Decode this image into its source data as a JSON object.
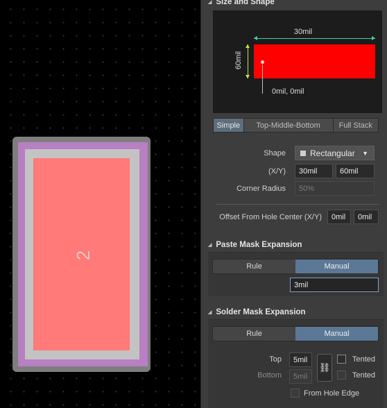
{
  "canvas": {
    "pad_designator": "2"
  },
  "size_and_shape": {
    "title": "Size and Shape",
    "preview": {
      "width_label": "30mil",
      "height_label": "60mil",
      "origin_label": "0mil, 0mil"
    },
    "modes": [
      "Simple",
      "Top-Middle-Bottom",
      "Full Stack"
    ],
    "active_mode": "Simple",
    "shape_label": "Shape",
    "shape_value": "Rectangular",
    "xy_label": "(X/Y)",
    "x_value": "30mil",
    "y_value": "60mil",
    "corner_radius_label": "Corner Radius",
    "corner_radius_value": "50%",
    "offset_label": "Offset From Hole Center (X/Y)",
    "offset_x": "0mil",
    "offset_y": "0mil"
  },
  "paste_mask": {
    "title": "Paste Mask Expansion",
    "rule_label": "Rule",
    "manual_label": "Manual",
    "active": "Manual",
    "value": "3mil"
  },
  "solder_mask": {
    "title": "Solder Mask Expansion",
    "rule_label": "Rule",
    "manual_label": "Manual",
    "active": "Manual",
    "top_label": "Top",
    "top_value": "5mil",
    "bottom_label": "Bottom",
    "bottom_value": "5mil",
    "tented_label": "Tented",
    "tented_bottom_label": "Tented",
    "from_hole_edge_label": "From Hole Edge",
    "link_icon": "chain-link-icon"
  },
  "colors": {
    "copper": "#ff7a78",
    "solder_mask": "#b87fc2",
    "paste_mask": "#c3c3c3",
    "preview_shape": "#ff0000",
    "active_toggle": "#5b7896"
  }
}
